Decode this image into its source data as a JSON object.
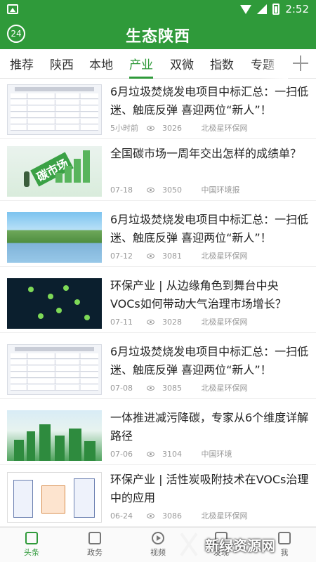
{
  "status_bar": {
    "time": "2:52"
  },
  "header": {
    "badge": "24",
    "title": "生态陕西"
  },
  "tabs": [
    "推荐",
    "陕西",
    "本地",
    "产业",
    "双微",
    "指数",
    "专题"
  ],
  "active_tab": "产业",
  "articles": [
    {
      "title": "6月垃圾焚烧发电项目中标汇总：一扫低迷、触底反弹 喜迎两位“新人”！",
      "time": "5小时前",
      "views": "3026",
      "source": "北极星环保网"
    },
    {
      "title": "全国碳市场一周年交出怎样的成绩单？",
      "time": "07-18",
      "views": "3050",
      "source": "中国环境报",
      "thumb_text": "碳市场"
    },
    {
      "title": "6月垃圾焚烧发电项目中标汇总：一扫低迷、触底反弹 喜迎两位“新人”！",
      "time": "07-12",
      "views": "3081",
      "source": "北极星环保网"
    },
    {
      "title": "环保产业 | 从边缘角色到舞台中央 VOCs如何带动大气治理市场增长？",
      "time": "07-11",
      "views": "3028",
      "source": "北极星环保网"
    },
    {
      "title": "6月垃圾焚烧发电项目中标汇总：一扫低迷、触底反弹 喜迎两位“新人”！",
      "time": "07-08",
      "views": "3085",
      "source": "北极星环保网"
    },
    {
      "title": "一体推进减污降碳，专家从6个维度详解路径",
      "time": "07-06",
      "views": "3104",
      "source": "中国环境"
    },
    {
      "title": "环保产业 | 活性炭吸附技术在VOCs治理中的应用",
      "time": "06-24",
      "views": "3086",
      "source": "北极星环保网"
    }
  ],
  "bottom_nav": [
    {
      "label": "头条",
      "icon": "news-icon"
    },
    {
      "label": "政务",
      "icon": "building-icon"
    },
    {
      "label": "视频",
      "icon": "play-icon"
    },
    {
      "label": "发现",
      "icon": "discover-icon"
    },
    {
      "label": "我",
      "icon": "user-icon"
    }
  ],
  "watermark": {
    "text": "新绿资源网"
  },
  "colors": {
    "brand": "#2f9a3a",
    "meta": "#999999"
  }
}
